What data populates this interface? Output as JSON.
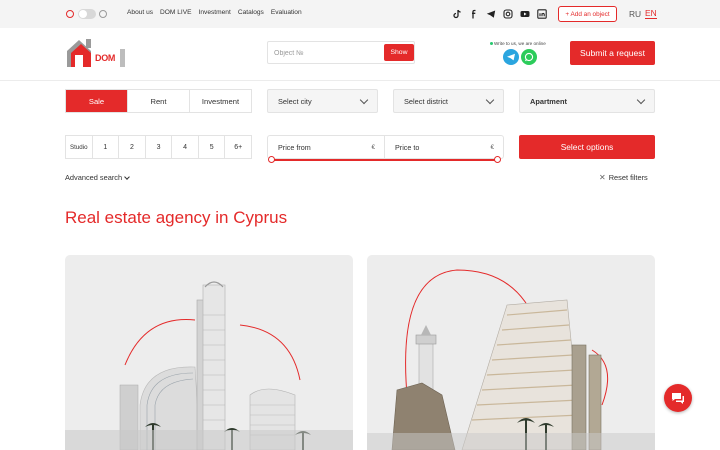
{
  "topbar": {
    "nav": [
      "About us",
      "DOM LIVE",
      "Investment",
      "Catalogs",
      "Evaluation"
    ],
    "add_object": "+ Add an object",
    "lang_ru": "RU",
    "lang_en": "EN",
    "socials": [
      "tiktok-icon",
      "facebook-icon",
      "telegram-icon",
      "instagram-icon",
      "youtube-icon",
      "linkedin-icon"
    ]
  },
  "header": {
    "logo_text": "DOM",
    "search_placeholder": "Object №",
    "show_label": "Show",
    "online_note": "Write to us, we are online",
    "submit_label": "Submit a request"
  },
  "filters": {
    "deal_types": [
      "Sale",
      "Rent",
      "Investment"
    ],
    "active_deal": "Sale",
    "city": "Select city",
    "district": "Select district",
    "property_type": "Apartment",
    "rooms": [
      "Studio",
      "1",
      "2",
      "3",
      "4",
      "5",
      "6+"
    ],
    "price_from": "Price from",
    "price_to": "Price to",
    "currency": "€",
    "options_label": "Select options",
    "advanced": "Advanced search",
    "reset": "Reset filters"
  },
  "main": {
    "title": "Real estate agency in Cyprus"
  },
  "colors": {
    "accent": "#e42a2a",
    "telegram": "#2ba5df",
    "whatsapp": "#2ccc5b"
  }
}
